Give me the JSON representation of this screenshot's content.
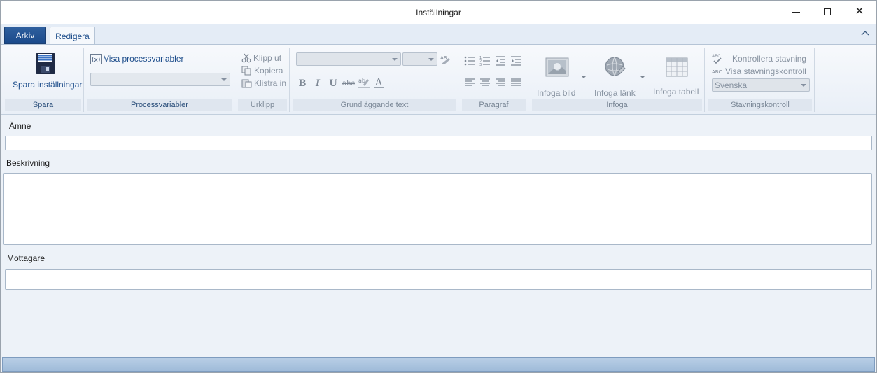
{
  "window": {
    "title": "Inställningar"
  },
  "tabs": {
    "file": "Arkiv",
    "edit": "Redigera"
  },
  "ribbon": {
    "spara": {
      "button_label": "Spara inställningar",
      "group_label": "Spara"
    },
    "processvariabler": {
      "toggle_label": "Visa processvariabler",
      "combo_value": "",
      "group_label": "Processvariabler"
    },
    "urklipp": {
      "cut": "Klipp ut",
      "copy": "Kopiera",
      "paste": "Klistra in",
      "group_label": "Urklipp"
    },
    "text": {
      "font_value": "",
      "size_value": "",
      "group_label": "Grundläggande text"
    },
    "paragraf": {
      "group_label": "Paragraf"
    },
    "infoga": {
      "image": "Infoga bild",
      "link": "Infoga länk",
      "table": "Infoga tabell",
      "group_label": "Infoga"
    },
    "stavning": {
      "check": "Kontrollera stavning",
      "show": "Visa stavningskontroll",
      "language": "Svenska",
      "group_label": "Stavningskontroll"
    }
  },
  "form": {
    "subject_label": "Ämne",
    "subject_value": "",
    "description_label": "Beskrivning",
    "description_value": "",
    "recipients_label": "Mottagare",
    "recipients_value": ""
  },
  "icons": {
    "save": "floppy-disk-icon",
    "variables": "variable-icon",
    "cut": "scissors-icon",
    "copy": "copy-icon",
    "paste": "paste-icon",
    "image": "image-icon",
    "link": "globe-link-icon",
    "table": "table-icon",
    "spellcheck": "spellcheck-icon"
  },
  "colors": {
    "accent": "#1b4a8b",
    "ribbon_label": "#2a4e7a",
    "status_bar": "#a8c2de"
  }
}
